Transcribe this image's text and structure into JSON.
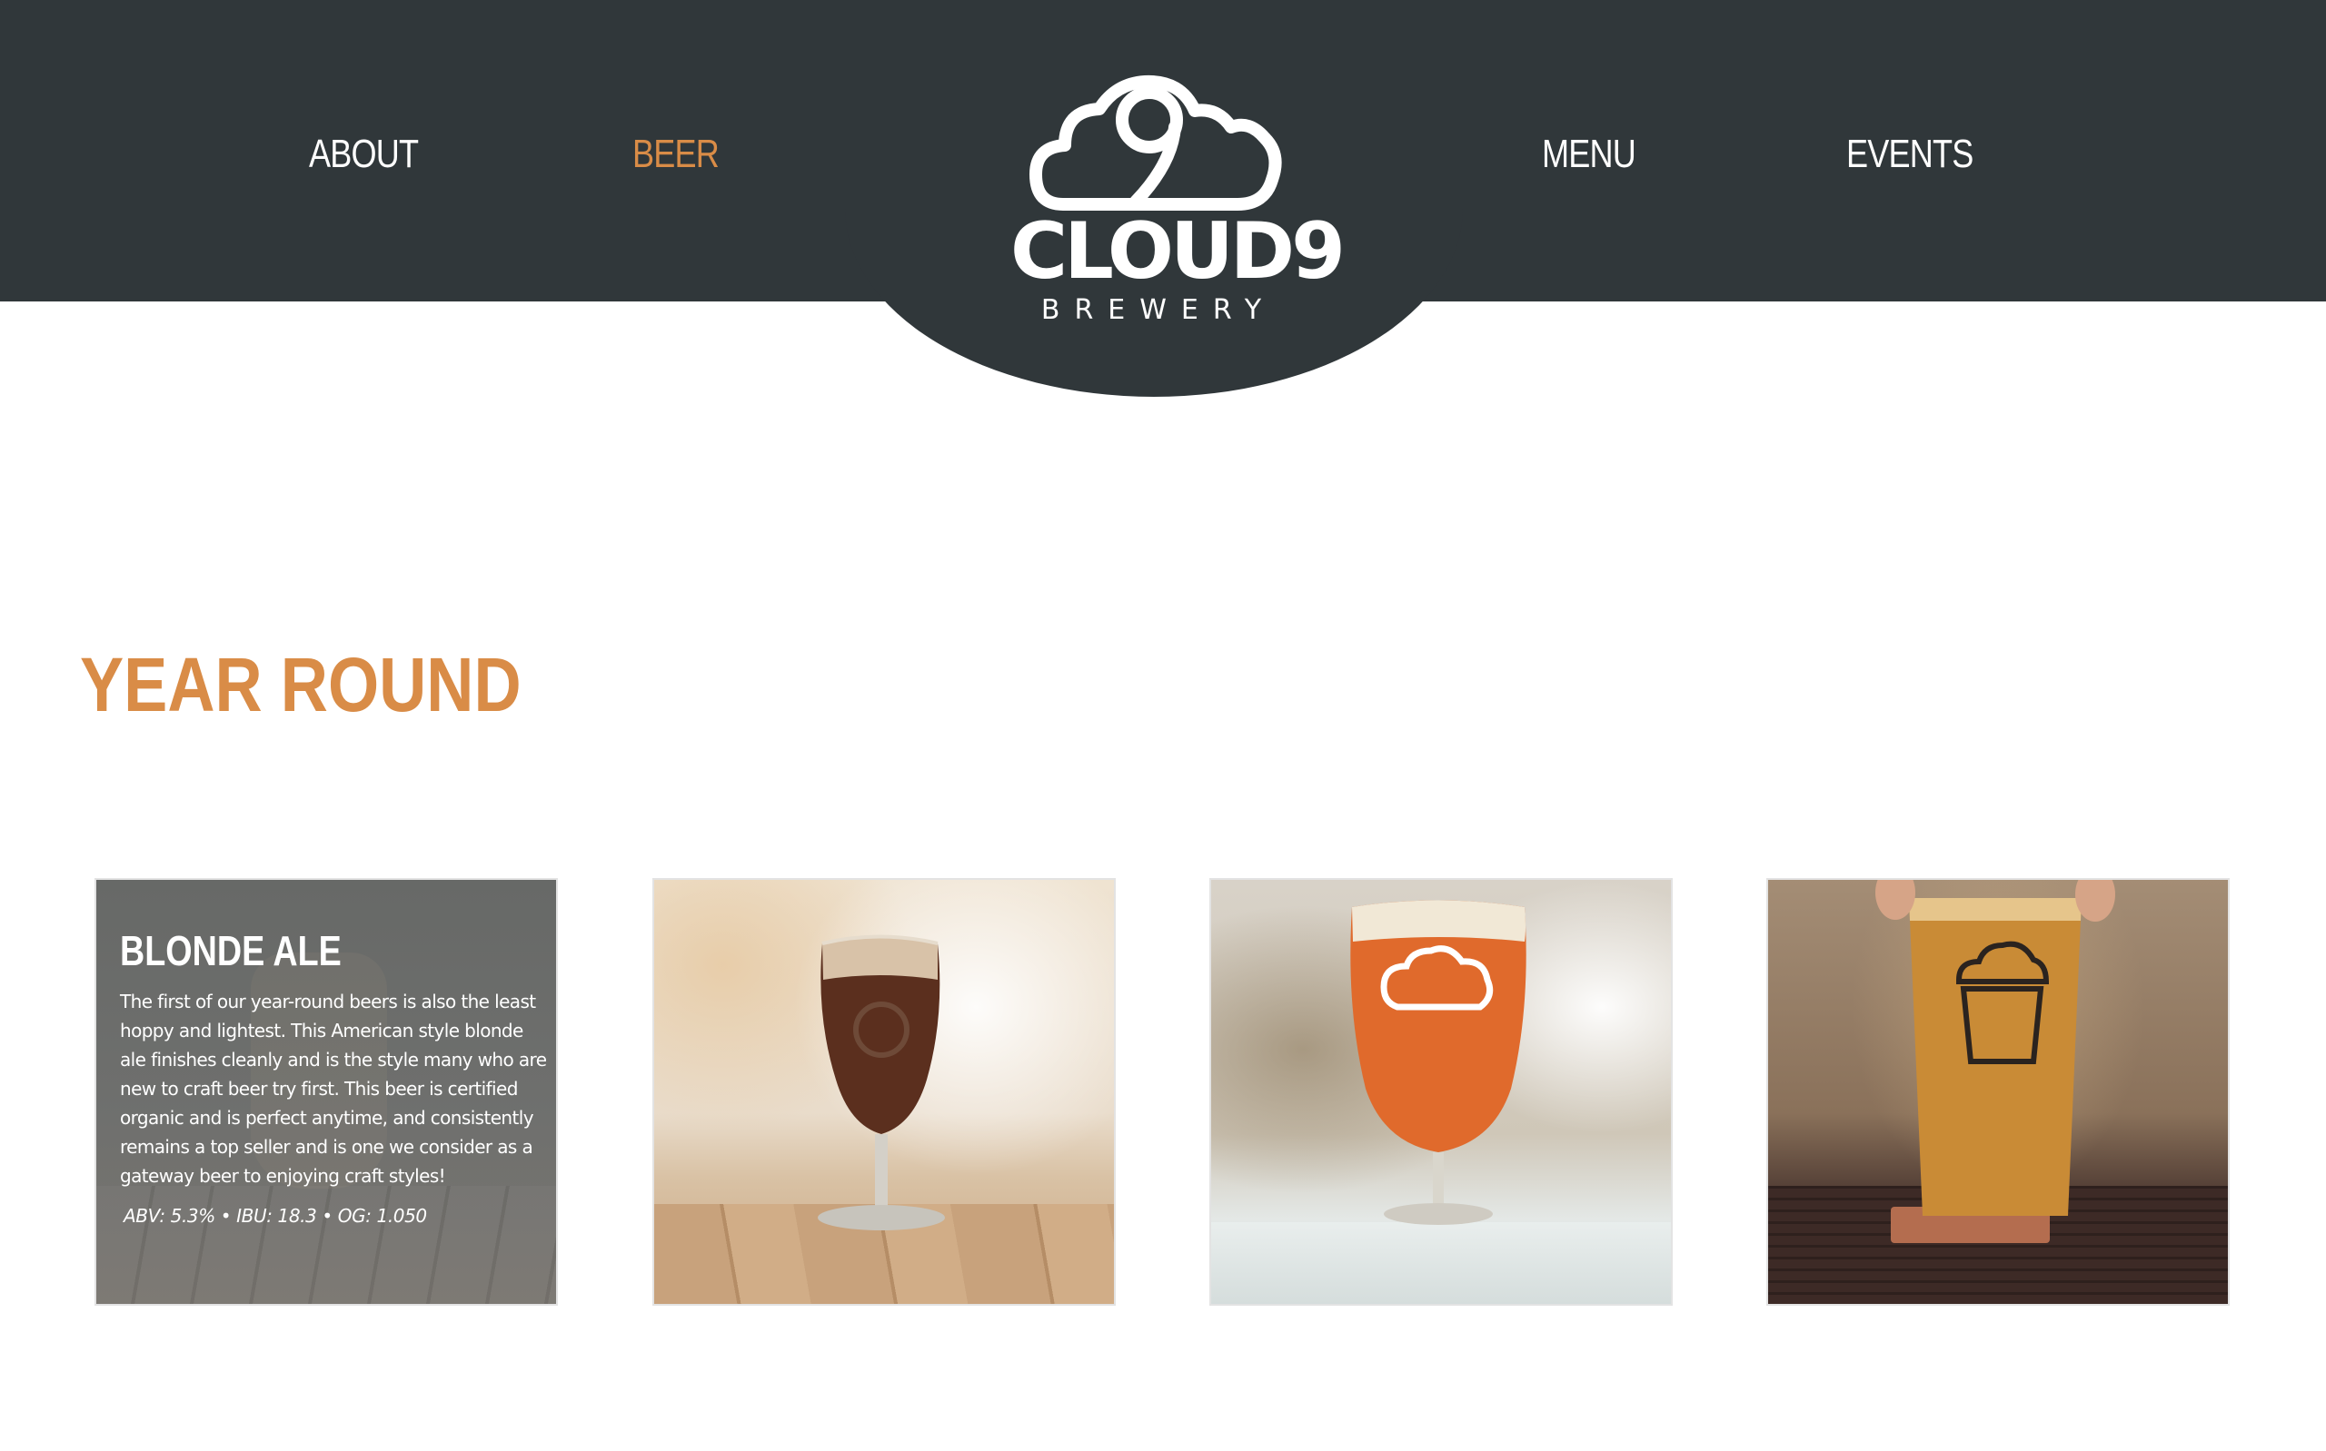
{
  "nav": {
    "about": "ABOUT",
    "beer": "BEER",
    "menu": "MENU",
    "events": "EVENTS",
    "active": "BEER"
  },
  "logo": {
    "name": "CLOUD9",
    "sub": "BREWERY"
  },
  "section": {
    "title": "YEAR ROUND"
  },
  "cards": [
    {
      "title": "BLONDE ALE",
      "description": "The first of our year-round beers is also the least hoppy and lightest. This American style blonde ale finishes cleanly and is the style many who are new to craft beer try first. This beer is certified organic and is perfect anytime, and consistently remains a top seller and is one we consider as a gateway beer to enjoying craft styles!",
      "stats": "ABV: 5.3% • IBU: 18.3 • OG: 1.050"
    },
    {
      "image": "beer-glass-dark-photo"
    },
    {
      "image": "beer-glass-amber-photo"
    },
    {
      "image": "beer-pint-photo"
    }
  ],
  "colors": {
    "header_bg": "#30373a",
    "accent": "#d98c47",
    "nav_text": "#ffffff"
  }
}
